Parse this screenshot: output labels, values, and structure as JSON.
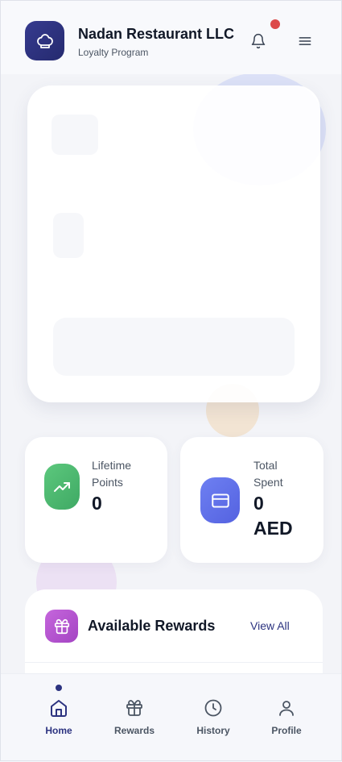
{
  "header": {
    "title": "Nadan Restaurant LLC",
    "subtitle": "Loyalty Program",
    "logo_icon": "chef-hat-icon",
    "notification_icon": "bell-icon",
    "menu_icon": "hamburger-menu-icon"
  },
  "stats": {
    "lifetime": {
      "label": "Lifetime Points",
      "value": "0",
      "icon": "trending-up-icon"
    },
    "spent": {
      "label": "Total Spent",
      "value": "0 AED",
      "icon": "credit-card-icon"
    }
  },
  "rewards": {
    "title": "Available Rewards",
    "view_all": "View All",
    "icon": "gift-icon"
  },
  "nav": {
    "active": "home",
    "items": [
      {
        "id": "home",
        "label": "Home",
        "icon": "home-icon"
      },
      {
        "id": "rewards",
        "label": "Rewards",
        "icon": "gift-icon"
      },
      {
        "id": "history",
        "label": "History",
        "icon": "clock-icon"
      },
      {
        "id": "profile",
        "label": "Profile",
        "icon": "user-icon"
      }
    ]
  },
  "colors": {
    "brand": "#2c3380",
    "notification": "#dc4a4a",
    "points_gradient": [
      "#5cc87d",
      "#3fa964"
    ],
    "spent_gradient": [
      "#6e80f2",
      "#5462e0"
    ],
    "rewards_gradient": [
      "#c566dc",
      "#a444c3"
    ]
  }
}
